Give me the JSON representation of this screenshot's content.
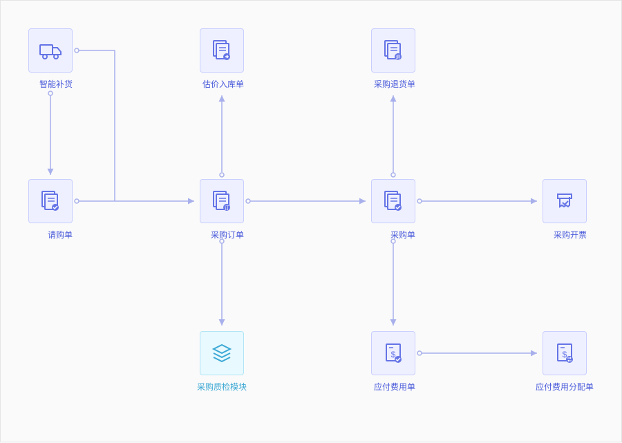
{
  "nodes": {
    "smart_replenish": "智能补货",
    "purchase_request": "请购单",
    "valuation_inbound": "估价入库单",
    "purchase_order": "采购订单",
    "purchase_return": "采购退货单",
    "purchase_receipt": "采购单",
    "purchase_invoice": "采购开票",
    "qc_module": "采购质检模块",
    "payable_expense": "应付费用单",
    "payable_expense_alloc": "应付费用分配单"
  },
  "colors": {
    "primary_stroke": "#6574e6",
    "secondary_stroke": "#3ba8d4",
    "arrow": "#a8b0ec"
  }
}
